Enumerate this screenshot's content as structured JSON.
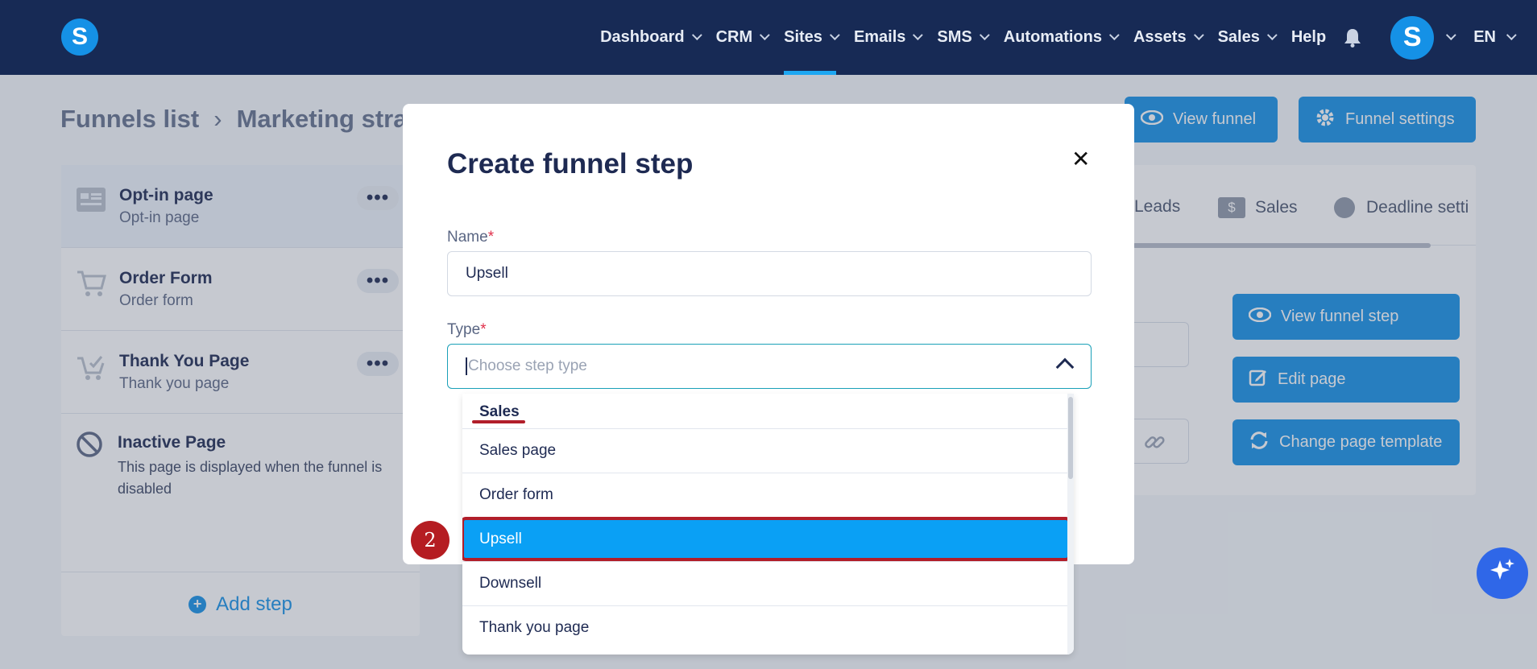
{
  "nav": {
    "logo": "S",
    "items": [
      {
        "label": "Dashboard",
        "dropdown": true,
        "active": false
      },
      {
        "label": "CRM",
        "dropdown": true,
        "active": false
      },
      {
        "label": "Sites",
        "dropdown": true,
        "active": true
      },
      {
        "label": "Emails",
        "dropdown": true,
        "active": false
      },
      {
        "label": "SMS",
        "dropdown": true,
        "active": false
      },
      {
        "label": "Automations",
        "dropdown": true,
        "active": false
      },
      {
        "label": "Assets",
        "dropdown": true,
        "active": false
      },
      {
        "label": "Sales",
        "dropdown": true,
        "active": false
      },
      {
        "label": "Help",
        "dropdown": false,
        "active": false
      }
    ],
    "avatar": "S",
    "language": "EN"
  },
  "breadcrumb": {
    "root": "Funnels list",
    "current": "Marketing strat"
  },
  "header_buttons": {
    "view_funnel": "View funnel",
    "funnel_settings": "Funnel settings"
  },
  "steps": [
    {
      "title": "Opt-in page",
      "subtitle": "Opt-in page",
      "icon": "page-icon"
    },
    {
      "title": "Order Form",
      "subtitle": "Order form",
      "icon": "cart-icon"
    },
    {
      "title": "Thank You Page",
      "subtitle": "Thank you page",
      "icon": "cart-check-icon"
    }
  ],
  "inactive": {
    "title": "Inactive Page",
    "description": "This page is displayed when the funnel is disabled"
  },
  "add_step": "Add step",
  "right_tabs": [
    "Leads",
    "Sales",
    "Deadline setti"
  ],
  "right_buttons": {
    "view_step": "View funnel step",
    "edit_page": "Edit page",
    "change_template": "Change page template"
  },
  "modal": {
    "title": "Create funnel step",
    "name_label": "Name",
    "name_value": "Upsell",
    "type_label": "Type",
    "type_placeholder": "Choose step type",
    "required_mark": "*"
  },
  "dropdown": {
    "group": "Sales",
    "options": [
      "Sales page",
      "Order form",
      "Upsell",
      "Downsell",
      "Thank you page"
    ],
    "selected": "Upsell"
  },
  "annotation_badge": "2",
  "colors": {
    "nav_bg": "#172a55",
    "primary": "#1591e6",
    "selected": "#0aa0f5",
    "highlight": "#b11e2a"
  }
}
